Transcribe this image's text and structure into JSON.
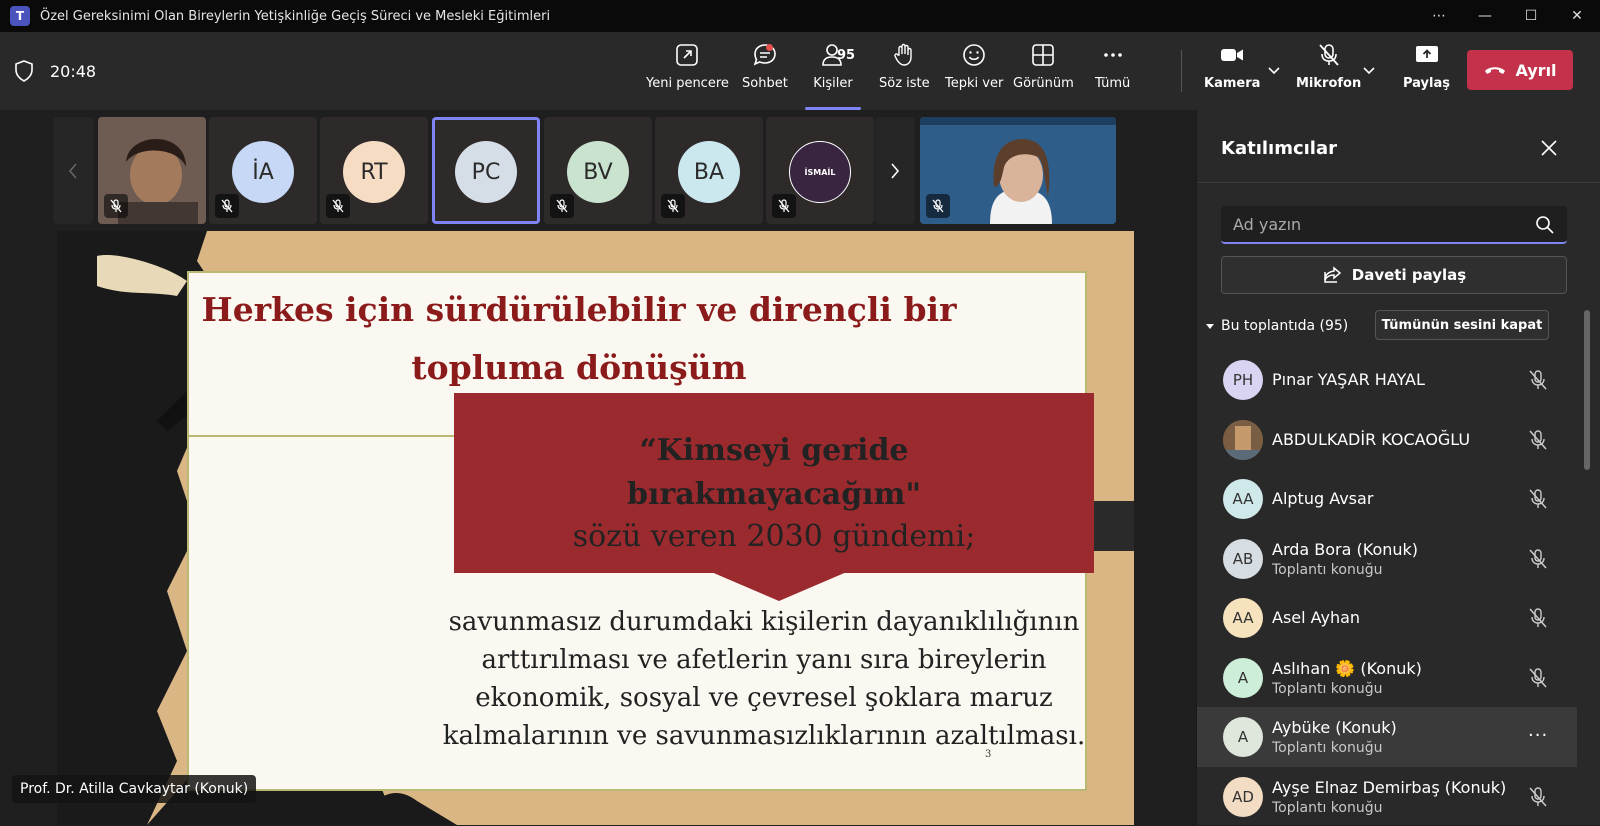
{
  "window": {
    "title": "Özel Gereksinimi Olan Bireylerin Yetişkinliğe Geçiş Süreci ve Mesleki Eğitimleri",
    "app_icon_label": "T",
    "controls": [
      "⋯",
      "—",
      "☐",
      "✕"
    ]
  },
  "toolbar": {
    "time": "20:48",
    "buttons": {
      "new_window": "Yeni pencere",
      "chat": "Sohbet",
      "people": "Kişiler",
      "people_count": "95",
      "raise_hand": "Söz iste",
      "react": "Tepki ver",
      "view": "Görünüm",
      "more": "Tümü",
      "camera": "Kamera",
      "mic": "Mikrofon",
      "share": "Paylaş",
      "leave": "Ayrıl"
    }
  },
  "gallery": {
    "tiles": [
      {
        "initials": "",
        "kind": "video"
      },
      {
        "initials": "İA",
        "color": "#c6d8f5"
      },
      {
        "initials": "RT",
        "color": "#f7dcc4"
      },
      {
        "initials": "PC",
        "color": "#d5dee6"
      },
      {
        "initials": "BV",
        "color": "#c9e3cf"
      },
      {
        "initials": "BA",
        "color": "#cbe8ee"
      },
      {
        "initials": "İSMAİL",
        "color": "#3a2540"
      }
    ]
  },
  "slide": {
    "title_line1": "Herkes için sürdürülebilir ve dirençli bir",
    "title_line2": "topluma dönüşüm",
    "quote_line1": "“Kimseyi geride",
    "quote_line2": "bırakmayacağım\"",
    "quote_sub": "sözü veren 2030 gündemi;",
    "body_line1": "savunmasız durumdaki kişilerin dayanıklılığının",
    "body_line2": "arttırılması ve afetlerin yanı sıra bireylerin",
    "body_line3": "ekonomik, sosyal ve çevresel şoklara maruz",
    "body_line4": "kalmalarının ve savunmasızlıklarının azaltılması.",
    "page_number": "3"
  },
  "presenter": {
    "name": "Prof. Dr. Atilla Cavkaytar (Konuk)"
  },
  "panel": {
    "title": "Katılımcılar",
    "search_placeholder": "Ad yazın",
    "share_invite": "Daveti paylaş",
    "section": "Bu toplantıda (95)",
    "mute_all": "Tümünün sesini kapat",
    "participants": [
      {
        "initials": "PH",
        "name": "Pınar YAŞAR HAYAL",
        "sub": "",
        "color": "#d9d4f2"
      },
      {
        "initials": "",
        "name": "ABDULKADİR KOCAOĞLU",
        "sub": "",
        "color": "#8a6e52"
      },
      {
        "initials": "AA",
        "name": "Alptug Avsar",
        "sub": "",
        "color": "#cfe8ea"
      },
      {
        "initials": "AB",
        "name": "Arda Bora (Konuk)",
        "sub": "Toplantı konuğu",
        "color": "#d6dde3"
      },
      {
        "initials": "AA",
        "name": "Asel Ayhan",
        "sub": "",
        "color": "#f6e3bd"
      },
      {
        "initials": "A",
        "name": "Aslıhan 🌼 (Konuk)",
        "sub": "Toplantı konuğu",
        "color": "#cdeed8"
      },
      {
        "initials": "A",
        "name": "Aybüke (Konuk)",
        "sub": "Toplantı konuğu",
        "color": "#dfe7dc"
      },
      {
        "initials": "AD",
        "name": "Ayşe Elnaz Demirbaş (Konuk)",
        "sub": "Toplantı konuğu",
        "color": "#f3dcc4"
      }
    ]
  }
}
